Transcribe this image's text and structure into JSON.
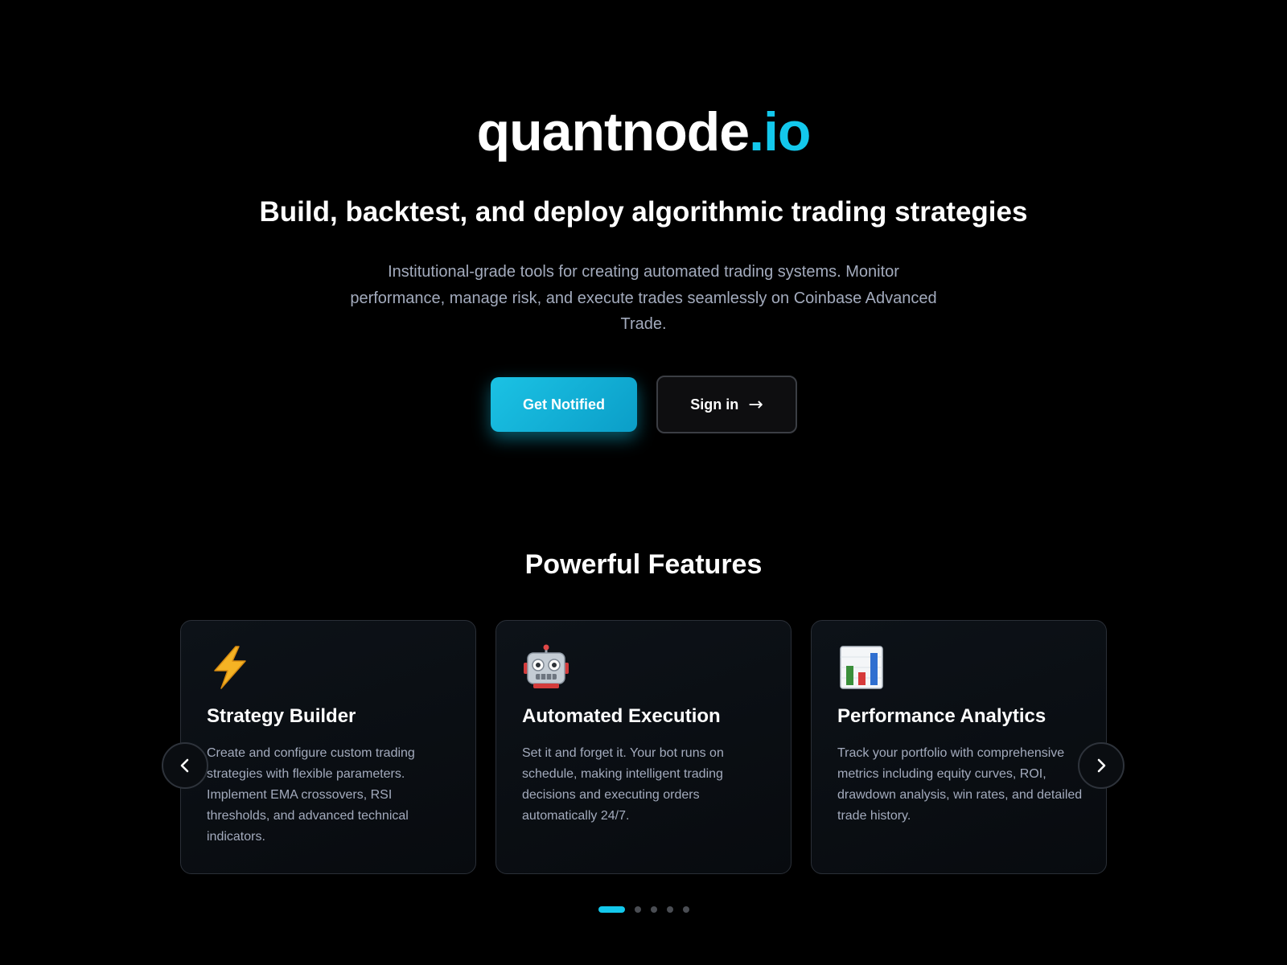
{
  "brand": {
    "name": "quantnode",
    "tld": ".io",
    "accent_color": "#13c8ec"
  },
  "hero": {
    "headline": "Build, backtest, and deploy algorithmic trading strategies",
    "description": "Institutional-grade tools for creating automated trading systems. Monitor performance, manage risk, and execute trades seamlessly on Coinbase Advanced Trade.",
    "primary_button": "Get Notified",
    "secondary_button": "Sign in",
    "secondary_button_icon": "arrow-right-icon"
  },
  "features": {
    "title": "Powerful Features",
    "cards": [
      {
        "icon": "lightning-icon",
        "title": "Strategy Builder",
        "text": "Create and configure custom trading strategies with flexible parameters. Implement EMA crossovers, RSI thresholds, and advanced technical indicators."
      },
      {
        "icon": "robot-icon",
        "title": "Automated Execution",
        "text": "Set it and forget it. Your bot runs on schedule, making intelligent trading decisions and executing orders automatically 24/7."
      },
      {
        "icon": "bar-chart-icon",
        "title": "Performance Analytics",
        "text": "Track your portfolio with comprehensive metrics including equity curves, ROI, drawdown analysis, win rates, and detailed trade history."
      }
    ],
    "carousel": {
      "prev_icon": "chevron-left-icon",
      "next_icon": "chevron-right-icon",
      "total_slides": 5,
      "active_slide": 1
    }
  }
}
